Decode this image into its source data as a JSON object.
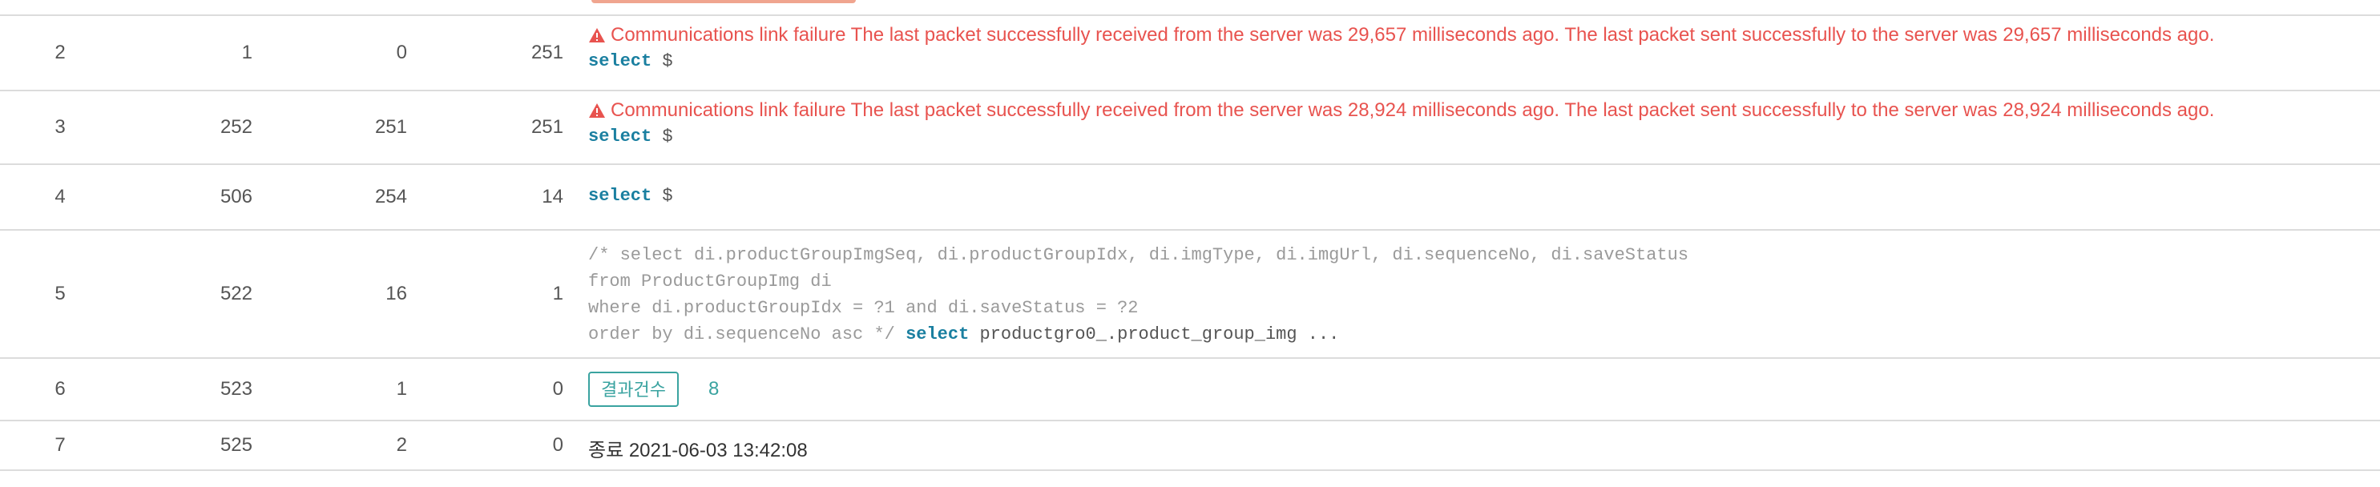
{
  "rows": [
    {
      "no": "2",
      "c2": "1",
      "c3": "0",
      "c4": "251",
      "error": "Communications link failure The last packet successfully received from the server was 29,657 milliseconds ago. The last packet sent successfully to the server was 29,657 milliseconds ago.",
      "sql_keyword": "select",
      "sql_rest": " $"
    },
    {
      "no": "3",
      "c2": "252",
      "c3": "251",
      "c4": "251",
      "error": "Communications link failure The last packet successfully received from the server was 28,924 milliseconds ago. The last packet sent successfully to the server was 28,924 milliseconds ago.",
      "sql_keyword": "select",
      "sql_rest": " $"
    },
    {
      "no": "4",
      "c2": "506",
      "c3": "254",
      "c4": "14",
      "sql_keyword": "select",
      "sql_rest": " $"
    },
    {
      "no": "5",
      "c2": "522",
      "c3": "16",
      "c4": "1",
      "sql_lines": [
        "/* select di.productGroupImgSeq, di.productGroupIdx, di.imgType, di.imgUrl, di.sequenceNo, di.saveStatus",
        "from ProductGroupImg di",
        "where di.productGroupIdx = ?1 and di.saveStatus = ?2",
        "order by di.sequenceNo asc */"
      ],
      "sql_tail_keyword": "select",
      "sql_tail_rest": " productgro0_.product_group_img ..."
    },
    {
      "no": "6",
      "c2": "523",
      "c3": "1",
      "c4": "0",
      "result_label": "결과건수",
      "result_count": "8"
    },
    {
      "no": "7",
      "c2": "525",
      "c3": "2",
      "c4": "0",
      "end_text": "종료 2021-06-03 13:42:08"
    }
  ],
  "colors": {
    "error": "#e8534f",
    "keyword": "#1a7fa0",
    "accent": "#3aa3a0"
  }
}
